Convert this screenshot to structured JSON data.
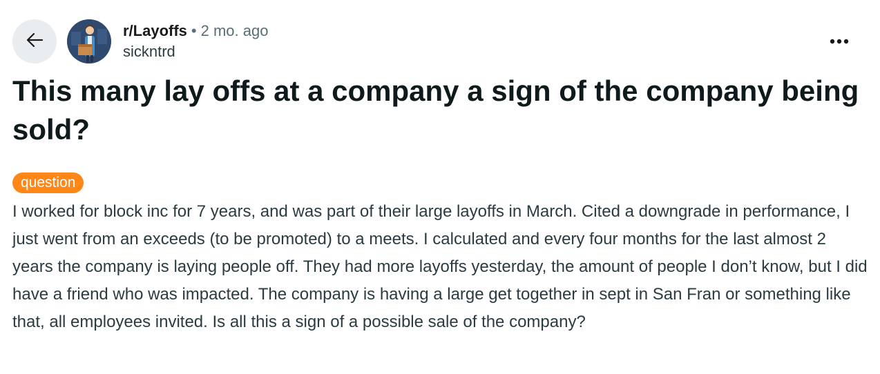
{
  "header": {
    "subreddit": "r/Layoffs",
    "separator": "•",
    "time_ago": "2 mo. ago",
    "author": "sickntrd"
  },
  "icons": {
    "back": "arrow-left-icon",
    "more": "more-horizontal-icon",
    "avatar": "subreddit-avatar"
  },
  "post": {
    "title": "This many lay offs at a company a sign of the company being sold?",
    "flair": "question",
    "body": "I worked for block inc for 7 years, and was part of their large layoffs in March. Cited a downgrade in performance, I just went from an exceeds (to be promoted) to a meets. I calculated and every four months for the last almost 2 years the company is laying people off. They had more layoffs yesterday, the amount of people I don’t know, but I did have a friend who was impacted. The company is having a large get together in sept in San Fran or something like that, all employees invited. Is all this a sign of a possible sale of the company?"
  },
  "colors": {
    "flair_bg": "#ff8717",
    "back_button_bg": "#eaedef",
    "avatar_bg": "#2f4a6e"
  }
}
